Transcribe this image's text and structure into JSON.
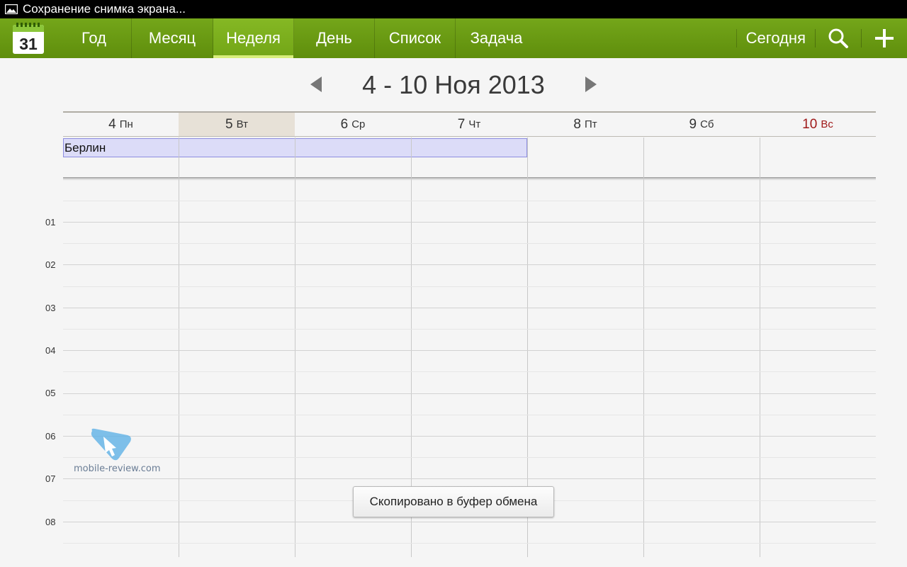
{
  "status_bar": {
    "text": "Сохранение снимка экрана..."
  },
  "app_icon": {
    "day": "31"
  },
  "tabs": [
    {
      "label": "Год",
      "active": false
    },
    {
      "label": "Месяц",
      "active": false
    },
    {
      "label": "Неделя",
      "active": true
    },
    {
      "label": "День",
      "active": false
    },
    {
      "label": "Список",
      "active": false
    },
    {
      "label": "Задача",
      "active": false
    }
  ],
  "actions": {
    "today_label": "Сегодня",
    "search_icon": "search-icon",
    "add_icon": "add-icon"
  },
  "week": {
    "title": "4 - 10 Ноя 2013"
  },
  "days": [
    {
      "num": "4",
      "dow": "Пн"
    },
    {
      "num": "5",
      "dow": "Вт",
      "today": true
    },
    {
      "num": "6",
      "dow": "Ср"
    },
    {
      "num": "7",
      "dow": "Чт"
    },
    {
      "num": "8",
      "dow": "Пт"
    },
    {
      "num": "9",
      "dow": "Сб"
    },
    {
      "num": "10",
      "dow": "Вс",
      "sunday": true
    }
  ],
  "all_day_event": {
    "title": "Берлин",
    "start_day": "4",
    "end_day": "7"
  },
  "hours": [
    "01",
    "02",
    "03",
    "04",
    "05",
    "06",
    "07",
    "08"
  ],
  "toast": {
    "text": "Скопировано в буфер обмена"
  },
  "watermark": {
    "text": "mobile-review.com"
  },
  "colors": {
    "accent": "#6b9c12",
    "today_bg": "#e7e1d7",
    "sunday": "#a01a1a",
    "event_bg": "#dcdcf8",
    "event_border": "#8d8de0"
  }
}
